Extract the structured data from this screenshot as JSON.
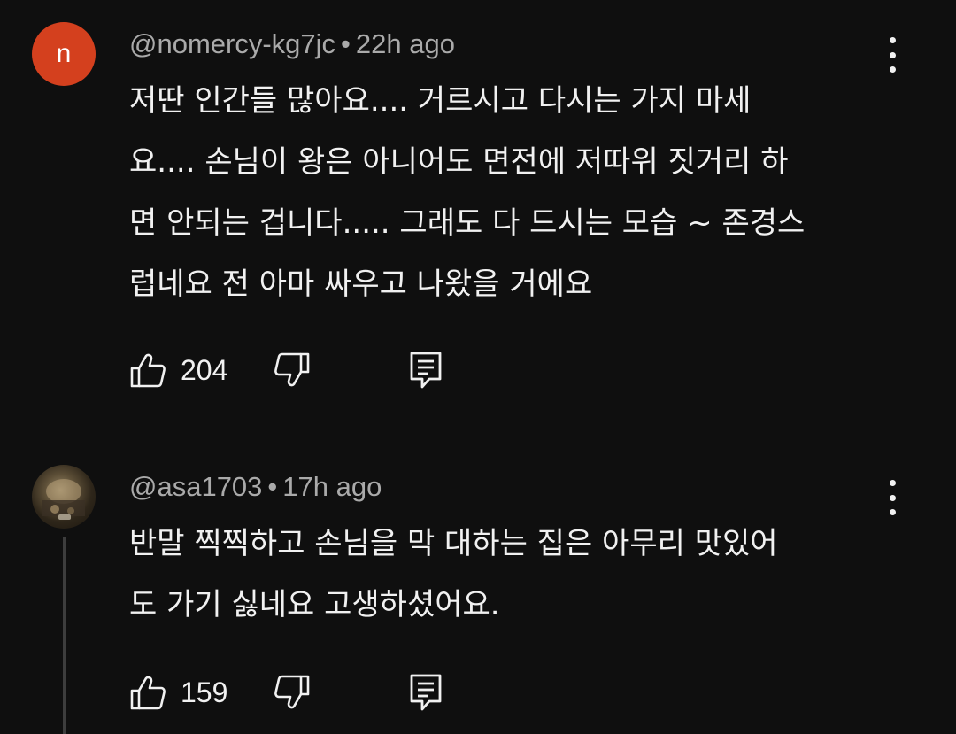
{
  "comments": [
    {
      "avatar_letter": "n",
      "author": "@nomercy-kg7jc",
      "separator": "•",
      "time": "22h ago",
      "text": "저딴 인간들 많아요.... 거르시고 다시는 가지 마세\n요.... 손님이 왕은 아니어도 면전에 저따위 짓거리 하\n면 안되는 겁니다..... 그래도 다 드시는 모습 ~ 존경스\n럽네요 전 아마 싸우고 나왔을 거에요",
      "likes": "204"
    },
    {
      "author": "@asa1703",
      "separator": "•",
      "time": "17h ago",
      "text": "반말 찍찍하고 손님을 막 대하는 집은 아무리 맛있어\n도 가기 싫네요 고생하셨어요.",
      "likes": "159"
    }
  ],
  "icons": {
    "like": "thumbs-up-icon",
    "dislike": "thumbs-down-icon",
    "reply": "reply-comment-icon",
    "menu": "more-vert-icon"
  },
  "colors": {
    "background": "#0f0f0f",
    "text": "#f1f1f1",
    "meta": "#aaaaaa",
    "avatar_n": "#d4401e"
  }
}
